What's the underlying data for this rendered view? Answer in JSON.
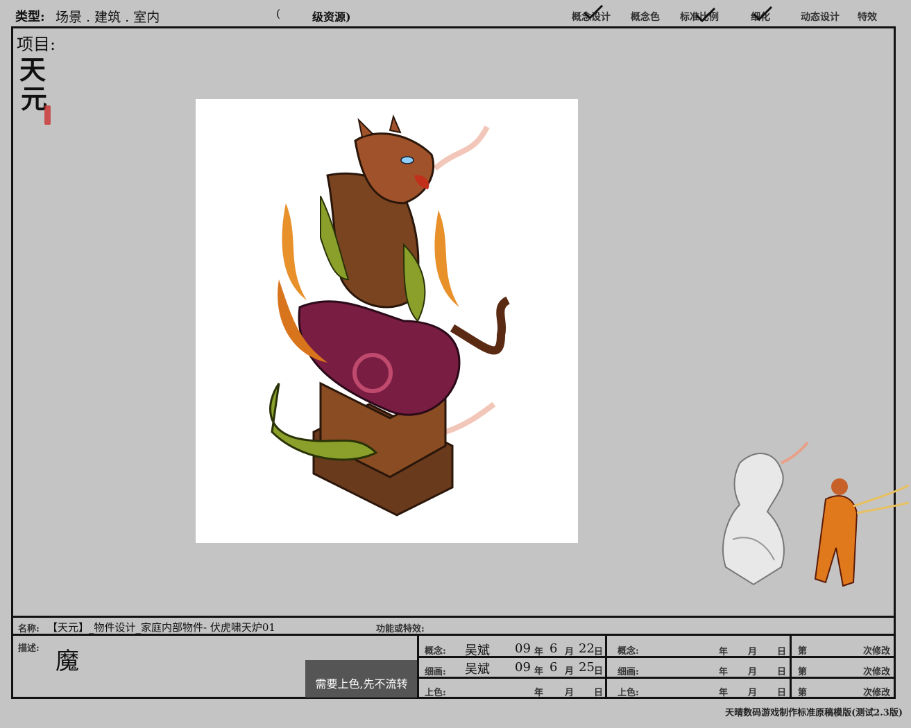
{
  "header": {
    "type_label": "类型:",
    "type_value": "场景 . 建筑 . 室内",
    "level_paren": "(",
    "level_label": "级资源)",
    "stages": [
      {
        "label": "概念设计",
        "checked": true
      },
      {
        "label": "概念色",
        "checked": false
      },
      {
        "label": "标准比例",
        "checked": true
      },
      {
        "label": "细化",
        "checked": true
      },
      {
        "label": "动态设计",
        "checked": false
      },
      {
        "label": "特效",
        "checked": false
      }
    ]
  },
  "project": {
    "label": "项目:",
    "logo_text": "天元"
  },
  "info": {
    "name_label": "名称:",
    "name_value": "【天元】_物件设计_家庭内部物件- 伏虎啸天炉01",
    "fx_label": "功能或特效:",
    "desc_label": "描述:",
    "desc_value": "魔",
    "note": "需要上色,先不流转"
  },
  "sign_table": {
    "left": [
      {
        "label": "概念:",
        "name": "吴斌",
        "year": "09",
        "y_unit": "年",
        "month": "6",
        "m_unit": "月",
        "day": "22",
        "d_unit": "日"
      },
      {
        "label": "细画:",
        "name": "吴斌",
        "year": "09",
        "y_unit": "年",
        "month": "6",
        "m_unit": "月",
        "day": "25",
        "d_unit": "日"
      },
      {
        "label": "上色:",
        "name": "",
        "year": "",
        "y_unit": "年",
        "month": "",
        "m_unit": "月",
        "day": "",
        "d_unit": "日"
      }
    ],
    "right": [
      {
        "label": "概念:",
        "y_unit": "年",
        "m_unit": "月",
        "d_unit": "日"
      },
      {
        "label": "细画:",
        "y_unit": "年",
        "m_unit": "月",
        "d_unit": "日"
      },
      {
        "label": "上色:",
        "y_unit": "年",
        "m_unit": "月",
        "d_unit": "日"
      }
    ],
    "revisions": [
      {
        "prefix": "第",
        "suffix": "次修改"
      },
      {
        "prefix": "第",
        "suffix": "次修改"
      },
      {
        "prefix": "第",
        "suffix": "次修改"
      }
    ]
  },
  "footer": "天晴数码游戏制作标准原稿模版(测试2.3版)"
}
